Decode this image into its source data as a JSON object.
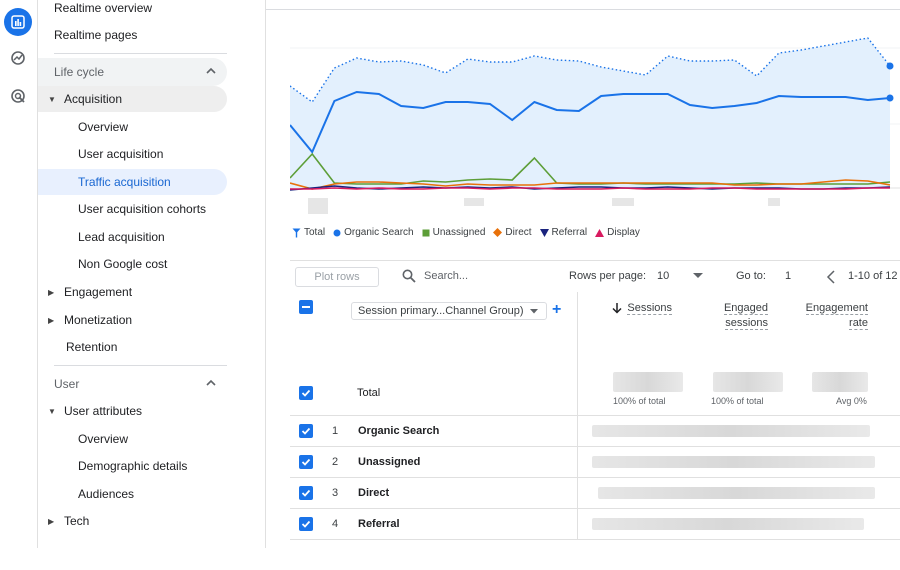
{
  "sidebar": {
    "realtime_overview": "Realtime overview",
    "realtime_pages": "Realtime pages",
    "life_cycle": "Life cycle",
    "acquisition": "Acquisition",
    "acq_items": [
      "Overview",
      "User acquisition",
      "Traffic acquisition",
      "User acquisition cohorts",
      "Lead acquisition",
      "Non Google cost"
    ],
    "engagement": "Engagement",
    "monetization": "Monetization",
    "retention": "Retention",
    "user": "User",
    "user_attributes": "User attributes",
    "ua_items": [
      "Overview",
      "Demographic details",
      "Audiences"
    ],
    "tech": "Tech"
  },
  "legend": [
    "Total",
    "Organic Search",
    "Unassigned",
    "Direct",
    "Referral",
    "Display"
  ],
  "colors": {
    "total": "#1a73e8",
    "organic": "#1a73e8",
    "unassigned": "#5d9e38",
    "direct": "#e8710a",
    "referral": "#1a237e",
    "display": "#d81b60",
    "accent": "#1a73e8"
  },
  "toolbar": {
    "plot_rows": "Plot rows",
    "search_placeholder": "Search...",
    "rows_per_page_label": "Rows per page:",
    "rows_per_page_value": "10",
    "goto_label": "Go to:",
    "goto_value": "1",
    "range": "1-10 of 12"
  },
  "table": {
    "dimension": "Session primary...Channel Group)",
    "metrics": [
      {
        "line1": "Sessions",
        "line2": ""
      },
      {
        "line1": "Engaged",
        "line2": "sessions"
      },
      {
        "line1": "Engagement",
        "line2": "rate"
      }
    ],
    "total_label": "Total",
    "totals_sub": [
      "100% of total",
      "100% of total",
      "Avg 0%"
    ],
    "rows": [
      {
        "idx": "1",
        "name": "Organic Search"
      },
      {
        "idx": "2",
        "name": "Unassigned"
      },
      {
        "idx": "3",
        "name": "Direct"
      },
      {
        "idx": "4",
        "name": "Referral"
      }
    ]
  }
}
